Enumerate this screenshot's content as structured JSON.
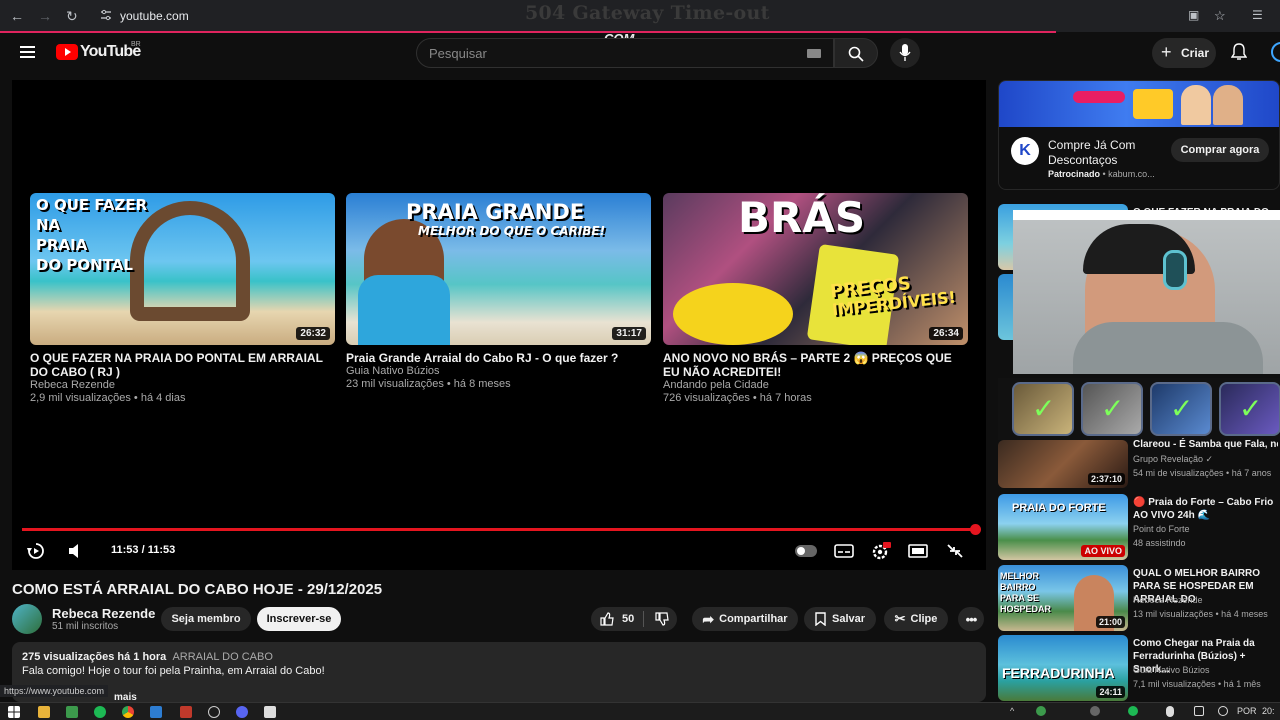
{
  "browser": {
    "url": "youtube.com",
    "overlay_title": "504 Gateway Time-out",
    "overlay_brand": "COM",
    "status_url": "https://www.youtube.com"
  },
  "header": {
    "logo_text": "YouTube",
    "region": "BR",
    "search_placeholder": "Pesquisar",
    "create_label": "Criar"
  },
  "player": {
    "time": "11:53 / 11:53",
    "progress": 1.0,
    "end_cards": [
      {
        "thumb_text": [
          "O QUE FAZER",
          "NA",
          "PRAIA",
          "DO PONTAL"
        ],
        "duration": "26:32",
        "title": "O QUE FAZER NA PRAIA DO PONTAL EM ARRAIAL DO CABO ( RJ )",
        "channel": "Rebeca Rezende",
        "meta": "2,9 mil visualizações • há 4 dias"
      },
      {
        "thumb_text": [
          "PRAIA GRANDE",
          "MELHOR DO QUE O CARIBE!"
        ],
        "duration": "31:17",
        "title": "Praia Grande Arraial do Cabo RJ - O que fazer ?",
        "channel": "Guia Nativo Búzios",
        "meta": "23 mil visualizações • há 8 meses"
      },
      {
        "thumb_text": [
          "BRÁS",
          "PREÇOS",
          "IMPERDÍVEIS!"
        ],
        "duration": "26:34",
        "title": "ANO NOVO NO BRÁS – PARTE 2 😱 PREÇOS QUE EU NÃO ACREDITEI!",
        "channel": "Andando pela Cidade",
        "meta": "726 visualizações • há 7 horas"
      }
    ]
  },
  "video": {
    "title": "COMO ESTÁ ARRAIAL DO CABO HOJE - 29/12/2025",
    "channel": "Rebeca Rezende",
    "subscribers": "51 mil inscritos",
    "member_label": "Seja membro",
    "subscribe_label": "Inscrever-se",
    "likes": "50",
    "share_label": "Compartilhar",
    "save_label": "Salvar",
    "clip_label": "Clipe",
    "desc_stats": "275 visualizações  há 1 hora",
    "desc_tag": "ARRAIAL DO CABO",
    "desc_text": "Fala comigo! Hoje o tour foi pela Prainha, em Arraial do Cabo!",
    "desc_more": "mais"
  },
  "sidebar": {
    "ad": {
      "title": "Compre Já Com Descontaços",
      "sponsored": "Patrocinado",
      "domain": "kabum.co...",
      "cta": "Comprar agora"
    },
    "items": [
      {
        "title": "O QUE FAZER NA PRAIA DO",
        "channel": "",
        "meta": "",
        "duration": ""
      },
      {
        "title": "Clareou - É Samba que Fala, né",
        "channel": "Grupo Revelação ✓",
        "meta": "54 mi de visualizações • há 7 anos",
        "duration": "2:37:10"
      },
      {
        "title": "🔴 Praia do Forte – Cabo Frio AO VIVO 24h 🌊",
        "channel": "Point do Forte",
        "meta": "48 assistindo",
        "duration": "AO VIVO",
        "thumb_text": "PRAIA DO FORTE"
      },
      {
        "title": "QUAL O MELHOR BAIRRO PARA SE HOSPEDAR EM ARRAIAL DO",
        "channel": "Rebeca Rezende",
        "meta": "13 mil visualizações • há 4 meses",
        "duration": "21:00",
        "thumb_text": "MELHOR BAIRRO PARA SE HOSPEDAR"
      },
      {
        "title": "Como Chegar na Praia da Ferradurinha (Búzios) + Snork...",
        "channel": "Guia Nativo Búzios",
        "meta": "7,1 mil visualizações • há 1 mês",
        "duration": "24:11",
        "thumb_text": "FERRADURINHA"
      }
    ]
  },
  "taskbar": {
    "lang": "POR",
    "clock": "20:"
  }
}
